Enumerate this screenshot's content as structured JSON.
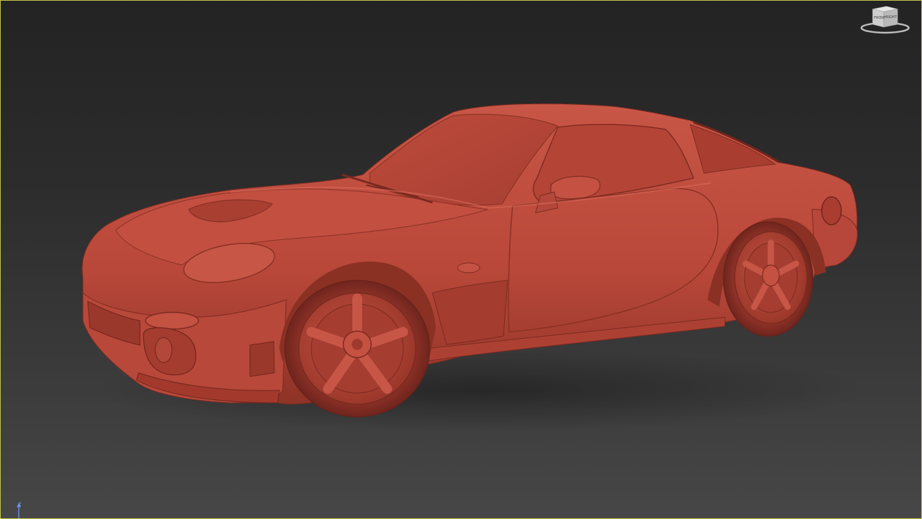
{
  "viewport": {
    "background_top": "#232323",
    "background_bottom": "#474747",
    "border_color": "#c8c84a",
    "model_color": "#c04a3c",
    "model_shadow_color": "#7f2c22",
    "model_highlight_color": "#d86a5a"
  },
  "viewcube": {
    "face_front": "FRONT",
    "face_right": "RIGHT"
  },
  "axis_gizmo": {
    "z_label": "z",
    "color": "#8aa6ff"
  }
}
